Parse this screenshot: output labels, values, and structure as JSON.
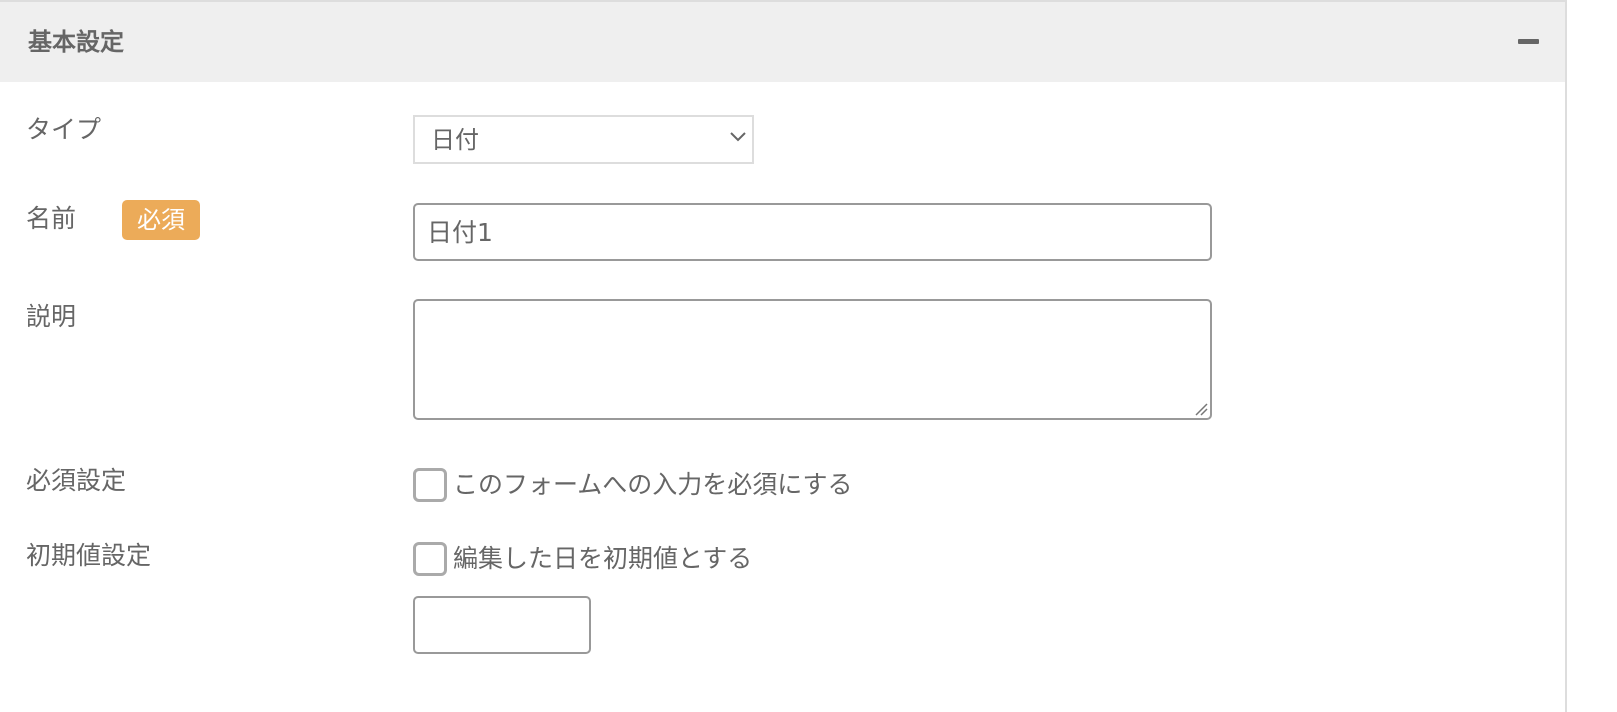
{
  "panel": {
    "title": "基本設定"
  },
  "fields": {
    "type": {
      "label": "タイプ",
      "value": "日付"
    },
    "name": {
      "label": "名前",
      "badge": "必須",
      "value": "日付1"
    },
    "description": {
      "label": "説明",
      "value": ""
    },
    "required_setting": {
      "label": "必須設定",
      "checkbox_label": "このフォームへの入力を必須にする",
      "checked": false
    },
    "default_setting": {
      "label": "初期値設定",
      "checkbox_label": "編集した日を初期値とする",
      "checked": false,
      "date_value": ""
    }
  },
  "colors": {
    "header_bg": "#efefef",
    "badge_bg": "#ecab59",
    "text": "#666666"
  },
  "icons": {
    "collapse": "minus-icon",
    "select": "chevron-down-icon",
    "resize": "resize-handle-icon"
  }
}
